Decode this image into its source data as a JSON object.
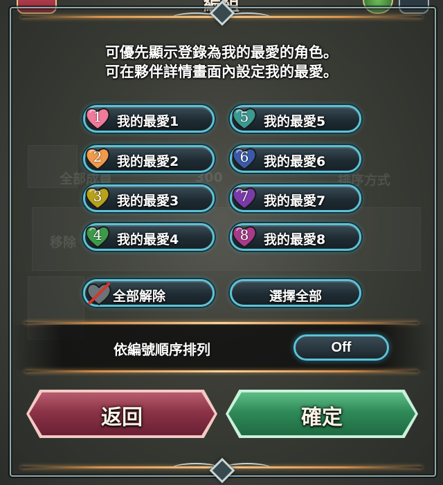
{
  "header": {
    "title": "編組"
  },
  "instruction": {
    "line1": "可優先顯示登錄為我的最愛的角色。",
    "line2": "可在夥伴詳情畫面內設定我的最愛。"
  },
  "favorites": [
    {
      "num": "1",
      "label": "我的最愛1",
      "color": "#f07a9a"
    },
    {
      "num": "2",
      "label": "我的最愛2",
      "color": "#f09a4a"
    },
    {
      "num": "3",
      "label": "我的最愛3",
      "color": "#b8a21c"
    },
    {
      "num": "4",
      "label": "我的最愛4",
      "color": "#3d9a4a"
    },
    {
      "num": "5",
      "label": "我的最愛5",
      "color": "#3a9a92"
    },
    {
      "num": "6",
      "label": "我的最愛6",
      "color": "#3a5aa8"
    },
    {
      "num": "7",
      "label": "我的最愛7",
      "color": "#7a3aa8"
    },
    {
      "num": "8",
      "label": "我的最愛8",
      "color": "#a83a8a"
    }
  ],
  "actions": {
    "clear_all": "全部解除",
    "select_all": "選擇全部"
  },
  "sort": {
    "label": "依編號順序排列",
    "value": "Off"
  },
  "buttons": {
    "back": "返回",
    "confirm": "確定"
  },
  "background": {
    "text1": "全部成員",
    "text2": "300",
    "text3": "排序方式",
    "text4": "移除"
  }
}
